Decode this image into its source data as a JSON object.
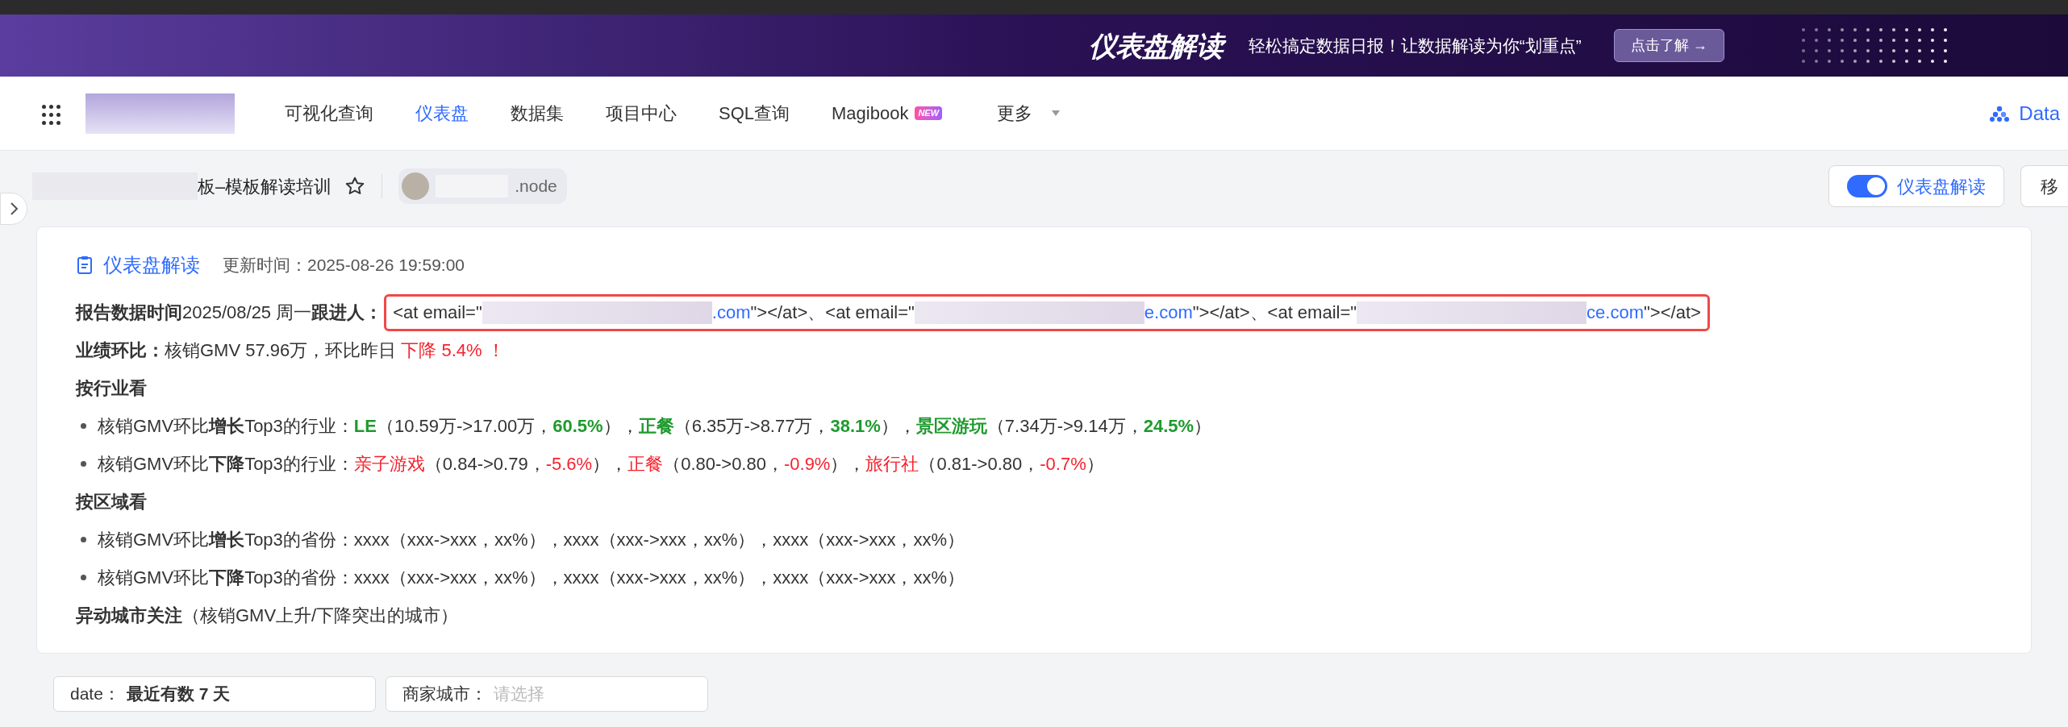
{
  "banner": {
    "title": "仪表盘解读",
    "slogan": "轻松搞定数据日报！让数据解读为你“划重点”",
    "button": "点击了解 →"
  },
  "nav": {
    "items": [
      {
        "label": "可视化查询",
        "selected": false
      },
      {
        "label": "仪表盘",
        "selected": true
      },
      {
        "label": "数据集",
        "selected": false
      },
      {
        "label": "项目中心",
        "selected": false
      },
      {
        "label": "SQL查询",
        "selected": false
      },
      {
        "label": "Magibook",
        "selected": false,
        "badge": "NEW"
      },
      {
        "label": "更多",
        "selected": false,
        "dropdown": true
      }
    ],
    "brand": "Data"
  },
  "title_bar": {
    "title": "板–模板解读培训",
    "starred": false,
    "owner": ".node",
    "toggle": {
      "label": "仪表盘解读",
      "on": true
    },
    "move_button": "移"
  },
  "card": {
    "title": "仪表盘解读",
    "updated": "更新时间：2025-08-26 19:59:00",
    "lines": [
      {
        "kind": "follower",
        "segments": [
          {
            "kind": "text",
            "text": "报告数据时间",
            "bold": true
          },
          {
            "kind": "text",
            "text": " 2025/08/25 周一 "
          },
          {
            "kind": "text",
            "text": "跟进人：",
            "bold": true
          },
          {
            "kind": "text",
            "text": "<at email=\"",
            "highlighted": true
          },
          {
            "kind": "redacted",
            "highlighted": true
          },
          {
            "kind": "link",
            "text": ".com",
            "highlighted": true
          },
          {
            "kind": "text",
            "text": "\"></at>、<at email=\"",
            "highlighted": true
          },
          {
            "kind": "redacted",
            "highlighted": true
          },
          {
            "kind": "link",
            "text": "e.com",
            "highlighted": true
          },
          {
            "kind": "text",
            "text": "\"></at>、<at email=\"",
            "highlighted": true
          },
          {
            "kind": "redacted",
            "highlighted": true
          },
          {
            "kind": "link",
            "text": "ce.com",
            "highlighted": true
          },
          {
            "kind": "text",
            "text": "\"></at>",
            "highlighted": true
          }
        ]
      },
      {
        "kind": "text",
        "segments": [
          {
            "text": "业绩环比：",
            "bold": true
          },
          {
            "text": "核销GMV 57.96万，环比昨日 "
          },
          {
            "text": "下降 5.4% ！",
            "color": "#f5222d"
          }
        ]
      },
      {
        "kind": "heading",
        "segments": [
          {
            "text": "按行业看",
            "bold": true
          }
        ]
      },
      {
        "kind": "bullet",
        "segments": [
          {
            "text": "核销GMV环比"
          },
          {
            "text": "增长",
            "bold": true
          },
          {
            "text": "Top3的行业："
          },
          {
            "text": "LE",
            "color": "#1f9a2e",
            "bold": true
          },
          {
            "text": "（10.59万->17.00万，"
          },
          {
            "text": "60.5%",
            "color": "#1f9a2e",
            "bold": true
          },
          {
            "text": "），"
          },
          {
            "text": "正餐",
            "color": "#1f9a2e",
            "bold": true
          },
          {
            "text": "（6.35万->8.77万，"
          },
          {
            "text": "38.1%",
            "color": "#1f9a2e",
            "bold": true
          },
          {
            "text": "），"
          },
          {
            "text": "景区游玩",
            "color": "#1f9a2e",
            "bold": true
          },
          {
            "text": "（7.34万->9.14万，"
          },
          {
            "text": "24.5%",
            "color": "#1f9a2e",
            "bold": true
          },
          {
            "text": "）"
          }
        ]
      },
      {
        "kind": "bullet",
        "segments": [
          {
            "text": "核销GMV环比"
          },
          {
            "text": "下降",
            "bold": true
          },
          {
            "text": "Top3的行业："
          },
          {
            "text": "亲子游戏",
            "color": "#f5222d"
          },
          {
            "text": "（0.84->0.79，"
          },
          {
            "text": "-5.6%",
            "color": "#f5222d"
          },
          {
            "text": "），"
          },
          {
            "text": "正餐",
            "color": "#f5222d"
          },
          {
            "text": "（0.80->0.80，"
          },
          {
            "text": "-0.9%",
            "color": "#f5222d"
          },
          {
            "text": "），"
          },
          {
            "text": "旅行社",
            "color": "#f5222d"
          },
          {
            "text": "（0.81->0.80，"
          },
          {
            "text": "-0.7%",
            "color": "#f5222d"
          },
          {
            "text": "）"
          }
        ]
      },
      {
        "kind": "heading",
        "segments": [
          {
            "text": "按区域看",
            "bold": true
          }
        ]
      },
      {
        "kind": "bullet",
        "segments": [
          {
            "text": "核销GMV环比"
          },
          {
            "text": "增长",
            "bold": true
          },
          {
            "text": "Top3的省份：xxxx（xxx->xxx，xx%），xxxx（xxx->xxx，xx%），xxxx（xxx->xxx，xx%）"
          }
        ]
      },
      {
        "kind": "bullet",
        "segments": [
          {
            "text": "核销GMV环比"
          },
          {
            "text": "下降",
            "bold": true
          },
          {
            "text": "Top3的省份：xxxx（xxx->xxx，xx%），xxxx（xxx->xxx，xx%），xxxx（xxx->xxx，xx%）"
          }
        ]
      },
      {
        "kind": "heading",
        "segments": [
          {
            "text": "异动城市关注",
            "bold": true
          },
          {
            "text": "（核销GMV上升/下降突出的城市）"
          }
        ]
      }
    ]
  },
  "filters": [
    {
      "label": "date：",
      "value": "最近有数 7 天"
    },
    {
      "label": "商家城市：",
      "placeholder": "请选择"
    }
  ]
}
